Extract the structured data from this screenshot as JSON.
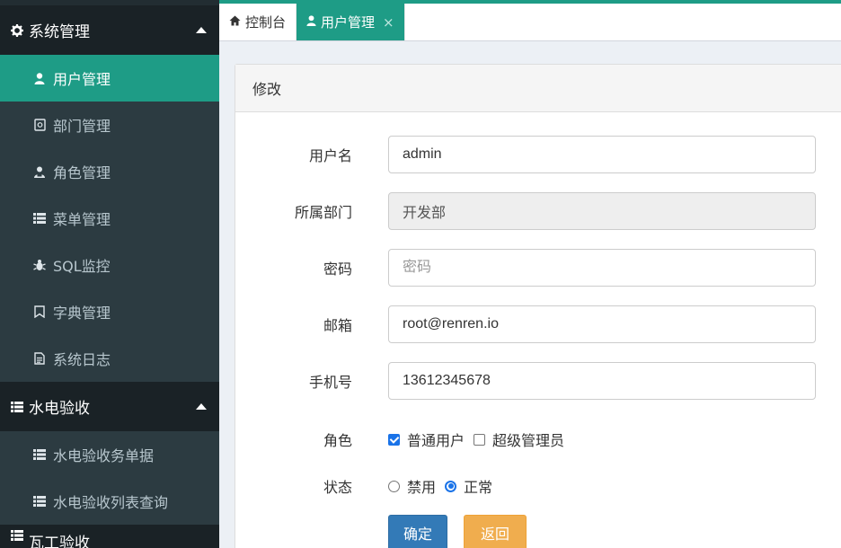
{
  "sidebar": {
    "groups": [
      {
        "label": "系统管理",
        "icon": "gear-icon",
        "items": [
          {
            "label": "用户管理",
            "icon": "user-icon",
            "active": true
          },
          {
            "label": "部门管理",
            "icon": "department-icon"
          },
          {
            "label": "角色管理",
            "icon": "role-icon"
          },
          {
            "label": "菜单管理",
            "icon": "list-icon"
          },
          {
            "label": "SQL监控",
            "icon": "bug-icon"
          },
          {
            "label": "字典管理",
            "icon": "bookmark-icon"
          },
          {
            "label": "系统日志",
            "icon": "file-icon"
          }
        ]
      },
      {
        "label": "水电验收",
        "icon": "list-icon",
        "items": [
          {
            "label": "水电验收务单据",
            "icon": "list-icon"
          },
          {
            "label": "水电验收列表查询",
            "icon": "list-icon"
          }
        ]
      },
      {
        "label": "瓦工验收",
        "icon": "list-icon"
      }
    ]
  },
  "tabs": [
    {
      "label": "控制台",
      "icon": "home-icon"
    },
    {
      "label": "用户管理",
      "icon": "user-icon",
      "active": true,
      "close": "×"
    }
  ],
  "panel": {
    "title": "修改"
  },
  "form": {
    "username": {
      "label": "用户名",
      "value": "admin"
    },
    "department": {
      "label": "所属部门",
      "value": "开发部"
    },
    "password": {
      "label": "密码",
      "placeholder": "密码"
    },
    "email": {
      "label": "邮箱",
      "value": "root@renren.io"
    },
    "mobile": {
      "label": "手机号",
      "value": "13612345678"
    },
    "roles": {
      "label": "角色",
      "options": [
        {
          "label": "普通用户",
          "checked": true
        },
        {
          "label": "超级管理员",
          "checked": false
        }
      ]
    },
    "status": {
      "label": "状态",
      "options": [
        {
          "label": "禁用",
          "checked": false
        },
        {
          "label": "正常",
          "checked": true
        }
      ]
    },
    "confirm_label": "确定",
    "back_label": "返回"
  },
  "colors": {
    "accent": "#1e9c86",
    "sidebar_bg": "#222d32",
    "primary": "#337ab7",
    "warning": "#f0ad4e"
  }
}
